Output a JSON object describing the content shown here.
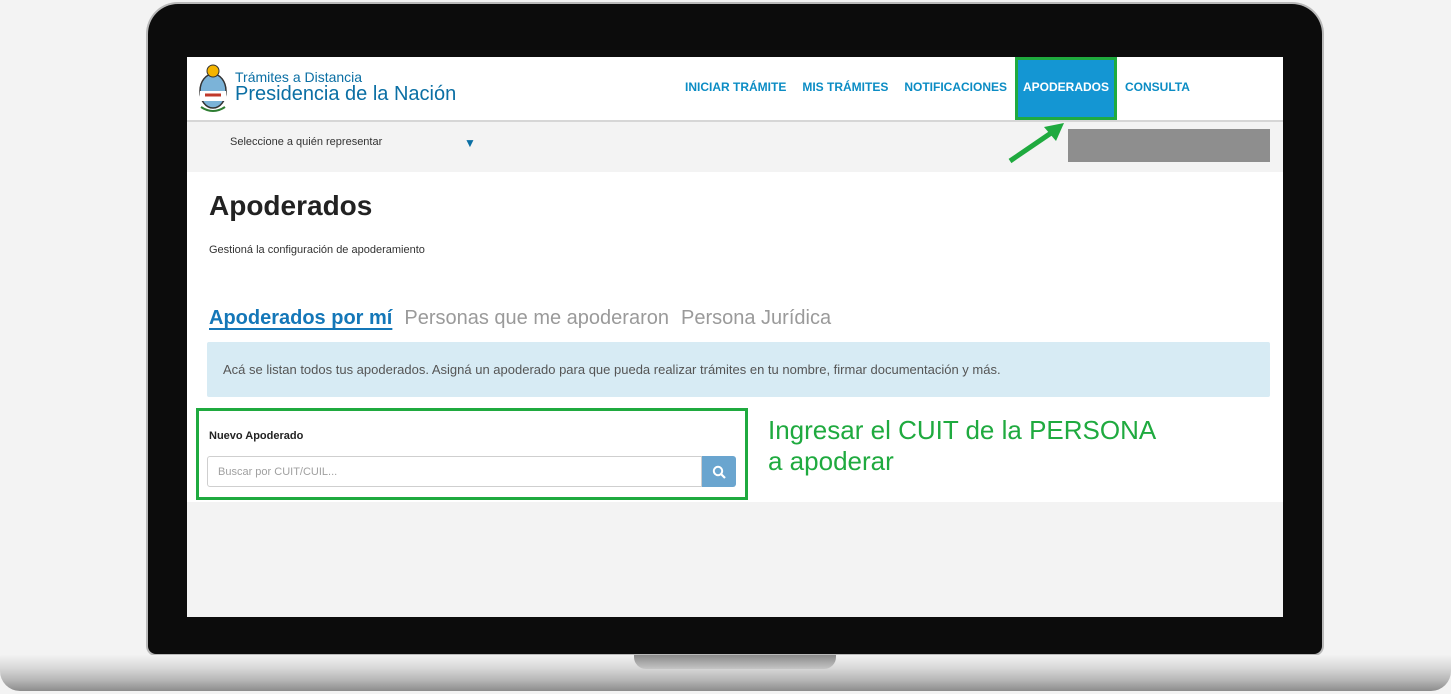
{
  "header": {
    "logo_line1": "Trámites a Distancia",
    "logo_line2": "Presidencia de la Nación",
    "nav": [
      {
        "label": "INICIAR TRÁMITE",
        "active": false
      },
      {
        "label": "MIS TRÁMITES",
        "active": false
      },
      {
        "label": "NOTIFICACIONES",
        "active": false
      },
      {
        "label": "APODERADOS",
        "active": true
      },
      {
        "label": "CONSULTA",
        "active": false
      }
    ]
  },
  "subbar": {
    "represent_select": "Seleccione a quién representar"
  },
  "page": {
    "title": "Apoderados",
    "subtitle": "Gestioná la configuración de apoderamiento"
  },
  "tabs": [
    {
      "label": "Apoderados por mí",
      "active": true
    },
    {
      "label": "Personas que me apoderaron",
      "active": false
    },
    {
      "label": "Persona Jurídica",
      "active": false
    }
  ],
  "info_message": "Acá se listan todos tus apoderados. Asigná un apoderado para que pueda realizar trámites en tu nombre, firmar documentación y más.",
  "new_proxy": {
    "label": "Nuevo Apoderado",
    "search_placeholder": "Buscar por CUIT/CUIL...",
    "search_value": ""
  },
  "annotation": {
    "line1": "Ingresar el CUIT de la PERSONA",
    "line2": "a apoderar"
  },
  "colors": {
    "brand_blue": "#0b6fa4",
    "nav_blue": "#0b8cc4",
    "active_nav_bg": "#1496d3",
    "highlight_green": "#1faa3f",
    "info_bg": "#d7ebf4"
  },
  "icons": {
    "search": "magnifier-icon",
    "caret": "triangle-down-icon",
    "emblem": "argentina-coat-of-arms"
  }
}
